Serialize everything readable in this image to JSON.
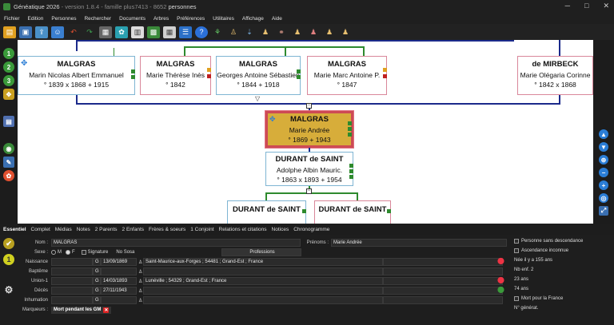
{
  "window": {
    "title_main": "Généatique 2026",
    "title_faded": " - version 1.8.4 - famille plus7413 - 8652",
    "title_end": " personnes"
  },
  "menu": [
    "Fichier",
    "Edition",
    "Personnes",
    "Rechercher",
    "Documents",
    "Arbres",
    "Préférences",
    "Utilitaires",
    "Affichage",
    "Aide"
  ],
  "tree": {
    "top": [
      {
        "surname": "MALGRAS",
        "given": "Marin Nicolas Albert Emmanuel",
        "dates": "° 1839   x 1868   + 1915"
      },
      {
        "surname": "MALGRAS",
        "given": "Marie Thérèse Inès",
        "dates": "° 1842"
      },
      {
        "surname": "MALGRAS",
        "given": "Georges Antoine Sébastien",
        "dates": "° 1844   + 1918"
      },
      {
        "surname": "MALGRAS",
        "given": "Marie Marc Antoine P.",
        "dates": "° 1847"
      },
      {
        "surname": "de MIRBECK",
        "given": "Marie Olégaria Corinne",
        "dates": "° 1842   x 1868"
      }
    ],
    "selected": {
      "surname": "MALGRAS",
      "given": "Marie Andrée",
      "dates": "° 1869   + 1943"
    },
    "spouse": {
      "surname": "DURANT de SAINT",
      "given": "Adolphe Albin Mauric.",
      "dates": "° 1863   x 1893   + 1954"
    },
    "children": [
      {
        "surname": "DURANT de SAINT"
      },
      {
        "surname": "DURANT de SAINT"
      }
    ]
  },
  "tabs": {
    "essentiel": "Essentiel",
    "complet": "Complet",
    "medias": "Médias",
    "notes": "Notes",
    "parents": "2 Parents",
    "enfants": "2 Enfants",
    "freres": "Frères & soeurs",
    "conjoint": "1 Conjoint",
    "relations": "Relations et citations",
    "notices": "Notices",
    "chrono": "Chronogramme"
  },
  "form": {
    "nom_label": "Nom :",
    "nom": "MALGRAS",
    "prenoms_label": "Prénoms :",
    "prenoms": "Marie Andrée",
    "sexe_label": "Sexe :",
    "sexe_m": "M",
    "sexe_f": "F",
    "signature": "Signature",
    "no_sosa": "No Sosa",
    "professions": "Professions",
    "events": [
      {
        "label": "Naissance",
        "g": "G",
        "date": "13/09/1869",
        "place": "Saint-Maurice-aux-Forges ; 54481 ; Grand-Est ; France"
      },
      {
        "label": "Baptême",
        "g": "G",
        "date": "",
        "place": ""
      },
      {
        "label": "Union-1",
        "g": "G",
        "date": "14/03/1893",
        "place": "Lunéville ; 54329 ; Grand-Est ; France"
      },
      {
        "label": "Décès",
        "g": "G",
        "date": "27/11/1943",
        "place": ""
      },
      {
        "label": "Inhumation",
        "g": "G",
        "date": "",
        "place": ""
      }
    ],
    "marqueurs_label": "Marqueurs :",
    "marqueur": "Mort pendant les GM"
  },
  "right_info": {
    "sans_descendance": "Personne sans descendance",
    "asc_inconnue": "Ascendance inconnue",
    "age_text": "Née il y a 155 ans",
    "nb_enf": "Nb enf. 2",
    "union_age": "23 ans",
    "deces_age": "74 ans",
    "mort_france": "Mort pour la France",
    "generat": "N° générat."
  },
  "colors": {
    "selected_bg": "#d7ad3a",
    "selected_border": "#cd4b55",
    "line_blue": "#1b2a8b",
    "line_green": "#2e8a2e"
  }
}
